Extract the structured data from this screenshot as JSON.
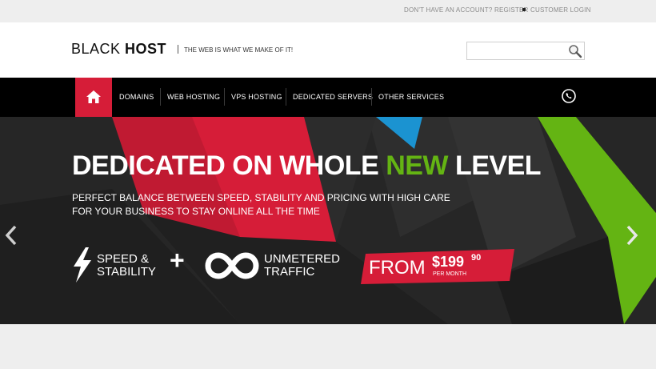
{
  "topbar": {
    "register_link": "DON'T HAVE AN ACCOUNT? REGISTER",
    "login_link": "CUSTOMER LOGIN"
  },
  "header": {
    "logo_light": "BLACK ",
    "logo_bold": "HOST",
    "tagline": "THE WEB IS WHAT WE MAKE OF IT!",
    "search_placeholder": "",
    "search_icon": "magnifier-icon"
  },
  "nav": {
    "home_icon": "home-icon",
    "items": [
      {
        "label": "DOMAINS"
      },
      {
        "label": "WEB HOSTING"
      },
      {
        "label": "VPS HOSTING"
      },
      {
        "label": "DEDICATED SERVERS"
      },
      {
        "label": "OTHER SERVICES"
      }
    ],
    "phone_icon": "phone-icon"
  },
  "hero": {
    "headline_part1": "DEDICATED ON WHOLE ",
    "headline_highlight": "NEW",
    "headline_part2": " LEVEL",
    "subline_1": "PERFECT BALANCE BETWEEN SPEED, STABILITY AND PRICING WITH HIGH CARE",
    "subline_2": "FOR YOUR BUSINESS TO STAY ONLINE ALL THE TIME",
    "feature1_line1": "SPEED &",
    "feature1_line2": "STABILITY",
    "plus": "+",
    "feature2_line1": "UNMETERED",
    "feature2_line2": "TRAFFIC",
    "price_from": "FROM",
    "price_amount": "$199",
    "price_cents": "90",
    "price_period": "PER MONTH",
    "prev_icon": "chevron-left-icon",
    "next_icon": "chevron-right-icon"
  },
  "colors": {
    "accent_red": "#d61d38",
    "accent_green": "#64b413",
    "accent_blue": "#1b93d1",
    "nav_bg": "#000000",
    "hero_bg": "#262626"
  }
}
